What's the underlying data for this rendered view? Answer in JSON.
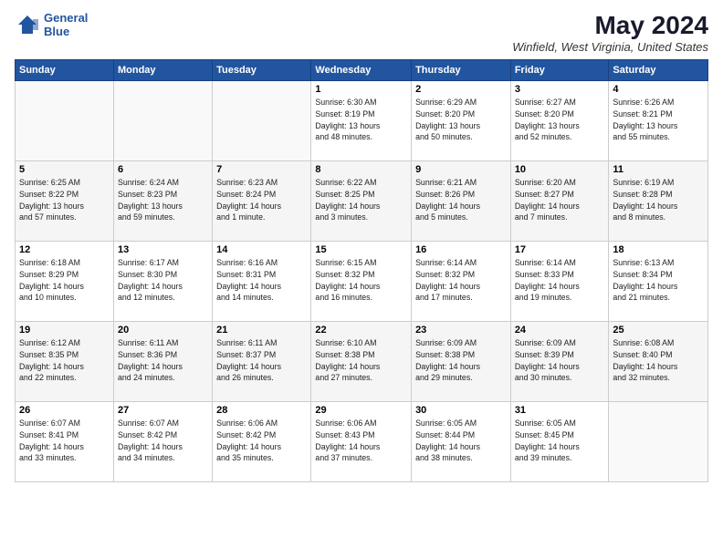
{
  "logo": {
    "line1": "General",
    "line2": "Blue"
  },
  "title": "May 2024",
  "subtitle": "Winfield, West Virginia, United States",
  "headers": [
    "Sunday",
    "Monday",
    "Tuesday",
    "Wednesday",
    "Thursday",
    "Friday",
    "Saturday"
  ],
  "weeks": [
    [
      {
        "day": "",
        "info": ""
      },
      {
        "day": "",
        "info": ""
      },
      {
        "day": "",
        "info": ""
      },
      {
        "day": "1",
        "info": "Sunrise: 6:30 AM\nSunset: 8:19 PM\nDaylight: 13 hours\nand 48 minutes."
      },
      {
        "day": "2",
        "info": "Sunrise: 6:29 AM\nSunset: 8:20 PM\nDaylight: 13 hours\nand 50 minutes."
      },
      {
        "day": "3",
        "info": "Sunrise: 6:27 AM\nSunset: 8:20 PM\nDaylight: 13 hours\nand 52 minutes."
      },
      {
        "day": "4",
        "info": "Sunrise: 6:26 AM\nSunset: 8:21 PM\nDaylight: 13 hours\nand 55 minutes."
      }
    ],
    [
      {
        "day": "5",
        "info": "Sunrise: 6:25 AM\nSunset: 8:22 PM\nDaylight: 13 hours\nand 57 minutes."
      },
      {
        "day": "6",
        "info": "Sunrise: 6:24 AM\nSunset: 8:23 PM\nDaylight: 13 hours\nand 59 minutes."
      },
      {
        "day": "7",
        "info": "Sunrise: 6:23 AM\nSunset: 8:24 PM\nDaylight: 14 hours\nand 1 minute."
      },
      {
        "day": "8",
        "info": "Sunrise: 6:22 AM\nSunset: 8:25 PM\nDaylight: 14 hours\nand 3 minutes."
      },
      {
        "day": "9",
        "info": "Sunrise: 6:21 AM\nSunset: 8:26 PM\nDaylight: 14 hours\nand 5 minutes."
      },
      {
        "day": "10",
        "info": "Sunrise: 6:20 AM\nSunset: 8:27 PM\nDaylight: 14 hours\nand 7 minutes."
      },
      {
        "day": "11",
        "info": "Sunrise: 6:19 AM\nSunset: 8:28 PM\nDaylight: 14 hours\nand 8 minutes."
      }
    ],
    [
      {
        "day": "12",
        "info": "Sunrise: 6:18 AM\nSunset: 8:29 PM\nDaylight: 14 hours\nand 10 minutes."
      },
      {
        "day": "13",
        "info": "Sunrise: 6:17 AM\nSunset: 8:30 PM\nDaylight: 14 hours\nand 12 minutes."
      },
      {
        "day": "14",
        "info": "Sunrise: 6:16 AM\nSunset: 8:31 PM\nDaylight: 14 hours\nand 14 minutes."
      },
      {
        "day": "15",
        "info": "Sunrise: 6:15 AM\nSunset: 8:32 PM\nDaylight: 14 hours\nand 16 minutes."
      },
      {
        "day": "16",
        "info": "Sunrise: 6:14 AM\nSunset: 8:32 PM\nDaylight: 14 hours\nand 17 minutes."
      },
      {
        "day": "17",
        "info": "Sunrise: 6:14 AM\nSunset: 8:33 PM\nDaylight: 14 hours\nand 19 minutes."
      },
      {
        "day": "18",
        "info": "Sunrise: 6:13 AM\nSunset: 8:34 PM\nDaylight: 14 hours\nand 21 minutes."
      }
    ],
    [
      {
        "day": "19",
        "info": "Sunrise: 6:12 AM\nSunset: 8:35 PM\nDaylight: 14 hours\nand 22 minutes."
      },
      {
        "day": "20",
        "info": "Sunrise: 6:11 AM\nSunset: 8:36 PM\nDaylight: 14 hours\nand 24 minutes."
      },
      {
        "day": "21",
        "info": "Sunrise: 6:11 AM\nSunset: 8:37 PM\nDaylight: 14 hours\nand 26 minutes."
      },
      {
        "day": "22",
        "info": "Sunrise: 6:10 AM\nSunset: 8:38 PM\nDaylight: 14 hours\nand 27 minutes."
      },
      {
        "day": "23",
        "info": "Sunrise: 6:09 AM\nSunset: 8:38 PM\nDaylight: 14 hours\nand 29 minutes."
      },
      {
        "day": "24",
        "info": "Sunrise: 6:09 AM\nSunset: 8:39 PM\nDaylight: 14 hours\nand 30 minutes."
      },
      {
        "day": "25",
        "info": "Sunrise: 6:08 AM\nSunset: 8:40 PM\nDaylight: 14 hours\nand 32 minutes."
      }
    ],
    [
      {
        "day": "26",
        "info": "Sunrise: 6:07 AM\nSunset: 8:41 PM\nDaylight: 14 hours\nand 33 minutes."
      },
      {
        "day": "27",
        "info": "Sunrise: 6:07 AM\nSunset: 8:42 PM\nDaylight: 14 hours\nand 34 minutes."
      },
      {
        "day": "28",
        "info": "Sunrise: 6:06 AM\nSunset: 8:42 PM\nDaylight: 14 hours\nand 35 minutes."
      },
      {
        "day": "29",
        "info": "Sunrise: 6:06 AM\nSunset: 8:43 PM\nDaylight: 14 hours\nand 37 minutes."
      },
      {
        "day": "30",
        "info": "Sunrise: 6:05 AM\nSunset: 8:44 PM\nDaylight: 14 hours\nand 38 minutes."
      },
      {
        "day": "31",
        "info": "Sunrise: 6:05 AM\nSunset: 8:45 PM\nDaylight: 14 hours\nand 39 minutes."
      },
      {
        "day": "",
        "info": ""
      }
    ]
  ]
}
